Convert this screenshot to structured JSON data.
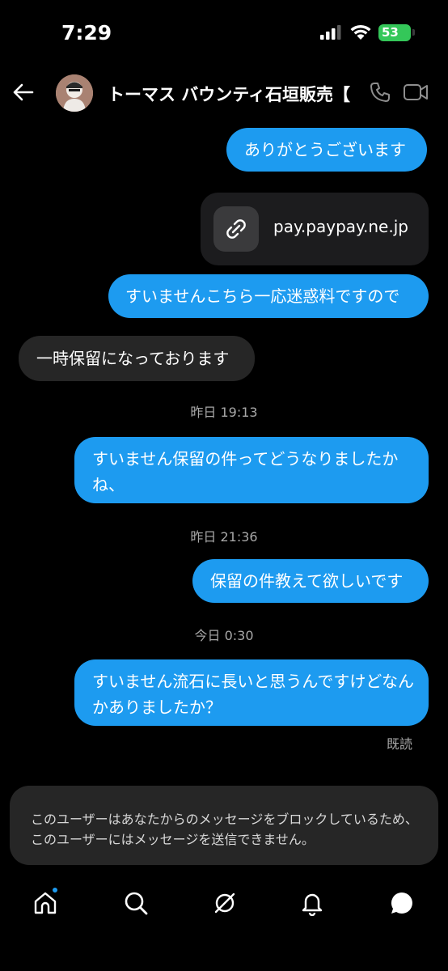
{
  "status_bar": {
    "time": "7:29",
    "battery": "53"
  },
  "header": {
    "title": "トーマス バウンティ石垣販売【..."
  },
  "messages": [
    {
      "text": "ありがとうございます",
      "direction": "out"
    },
    {
      "link": "pay.paypay.ne.jp",
      "direction": "out"
    },
    {
      "text": "すいませんこちら一応迷惑料ですので",
      "direction": "out"
    },
    {
      "text": "一時保留になっております",
      "direction": "in"
    },
    {
      "text": "すいません保留の件ってどうなりましたかね、",
      "direction": "out"
    },
    {
      "text": "保留の件教えて欲しいです",
      "direction": "out"
    },
    {
      "text": "すいません流石に長いと思うんですけどなんかありましたか？",
      "direction": "out"
    }
  ],
  "timestamps": [
    "昨日 19:13",
    "昨日 21:36",
    "今日 0:30"
  ],
  "read_receipt": "既読",
  "blocked_notice": "このユーザーはあなたからのメッセージをブロックしているため、このユーザーにはメッセージを送信できません。",
  "colors": {
    "accent": "#1d9bf0",
    "background": "#000000",
    "incoming_bubble": "#262626",
    "battery": "#34c759"
  },
  "tab_bar": {
    "icons": [
      "home-icon",
      "search-icon",
      "explore-icon",
      "notifications-icon",
      "messages-icon"
    ]
  }
}
